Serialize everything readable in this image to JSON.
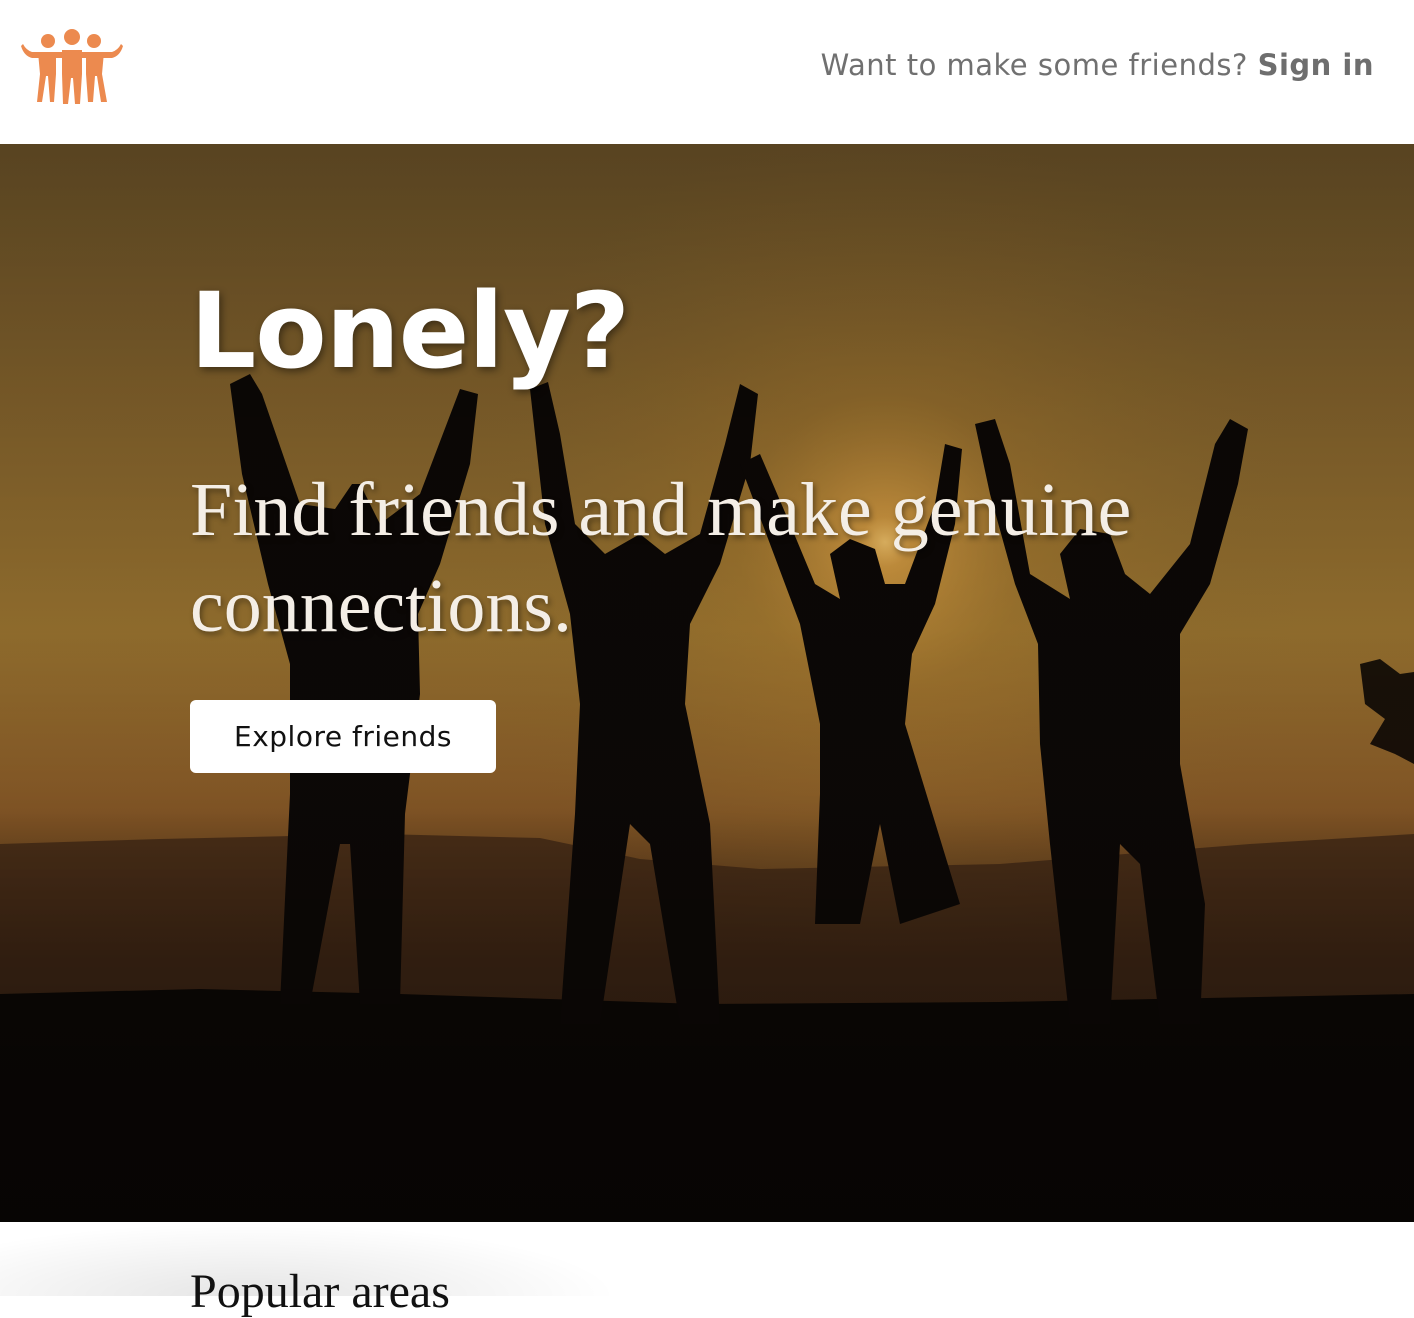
{
  "header": {
    "logo_icon": "friends-group-icon",
    "prompt_text": "Want to make some friends?",
    "signin_label": "Sign in",
    "accent_color": "#ec8a4f"
  },
  "hero": {
    "title": "Lonely?",
    "subtitle": "Find friends and make genuine connections.",
    "cta_label": "Explore friends",
    "background": "sunset-friends-silhouette-photo"
  },
  "sections": {
    "popular_title": "Popular areas"
  }
}
